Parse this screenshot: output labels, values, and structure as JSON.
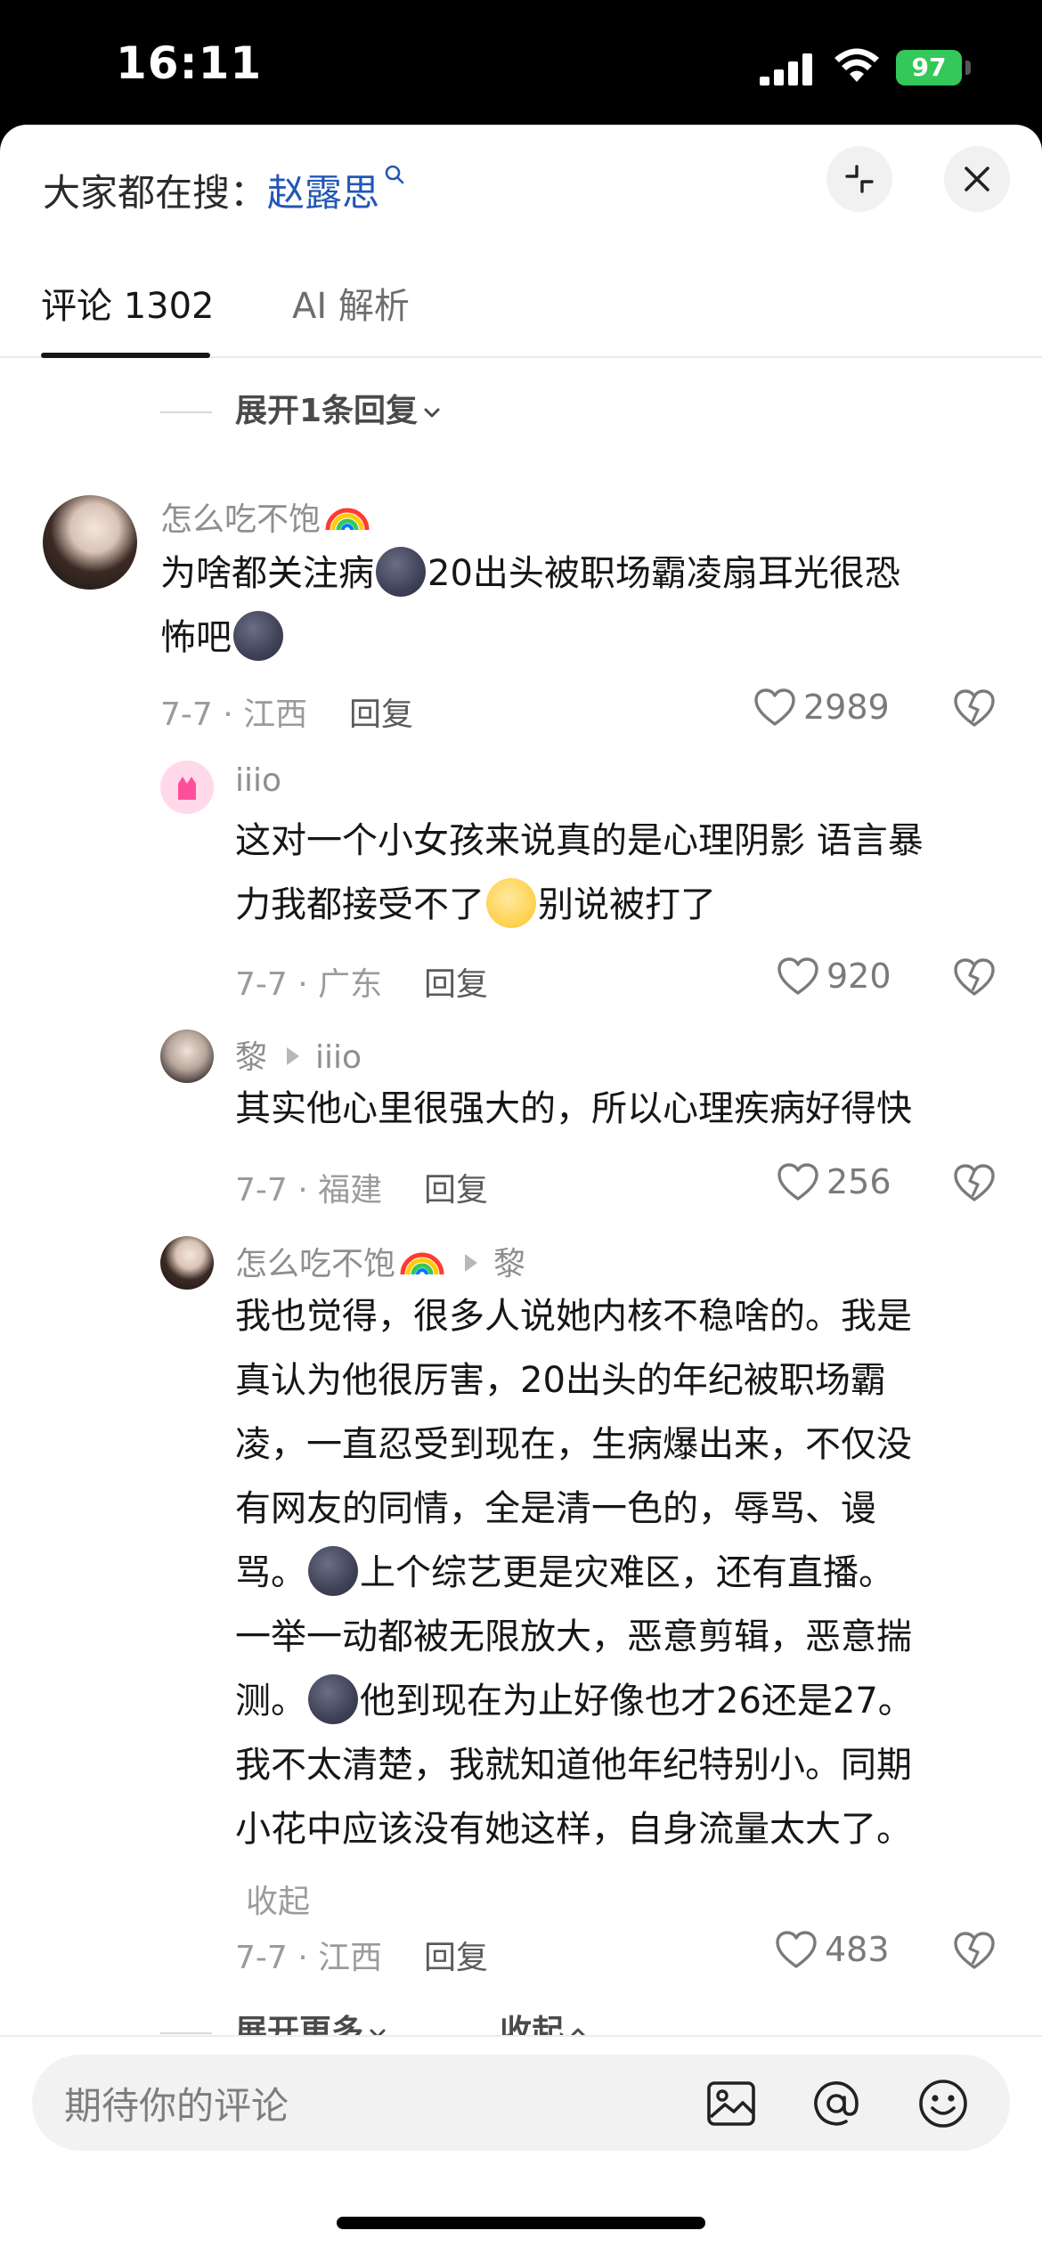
{
  "status_bar": {
    "time": "16:11",
    "battery": "97"
  },
  "header": {
    "search_prefix": "大家都在搜：",
    "search_keyword": "赵露思"
  },
  "tabs": [
    {
      "label": "评论 1302"
    },
    {
      "label": "AI 解析"
    }
  ],
  "expand_replies": "展开1条回复",
  "comments": [
    {
      "username": "怎么吃不饱",
      "text_parts": [
        "为啥都关注病",
        "20出头被职场霸凌扇耳光很恐",
        "怖吧"
      ],
      "date_location": "7-7 · 江西",
      "reply_label": "回复",
      "likes": "2989"
    },
    {
      "username": "iiio",
      "text_parts": [
        "这对一个小女孩来说真的是心理阴影 语言暴",
        "力我都接受不了",
        "别说被打了"
      ],
      "date_location": "7-7 · 广东",
      "reply_label": "回复",
      "likes": "920"
    },
    {
      "username": "黎",
      "reply_to": "iiio",
      "text": "其实他心里很强大的，所以心理疾病好得快",
      "date_location": "7-7 · 福建",
      "reply_label": "回复",
      "likes": "256"
    },
    {
      "username": "怎么吃不饱",
      "reply_to": "黎",
      "lines": [
        "我也觉得，很多人说她内核不稳啥的。我是",
        "真认为他很厉害，20出头的年纪被职场霸",
        "凌，一直忍受到现在，生病爆出来，不仅没",
        "有网友的同情，全是清一色的，辱骂、谩",
        "骂。",
        "上个综艺更是灾难区，还有直播。",
        "一举一动都被无限放大，恶意剪辑，恶意揣",
        "测。",
        "他到现在为止好像也才26还是27。",
        "我不太清楚，我就知道他年纪特别小。同期",
        "小花中应该没有她这样，自身流量太大了。"
      ],
      "collapse_label": "收起",
      "date_location": "7-7 · 江西",
      "reply_label": "回复",
      "likes": "483"
    }
  ],
  "more_row": {
    "expand_more": "展开更多",
    "collapse": "收起"
  },
  "bottom_bar": {
    "placeholder": "期待你的评论"
  },
  "icons": [
    "collapse-arrows-icon",
    "close-icon",
    "search-icon",
    "heart-icon",
    "broken-heart-icon",
    "image-icon",
    "at-icon",
    "emoji-icon",
    "rainbow-icon"
  ]
}
